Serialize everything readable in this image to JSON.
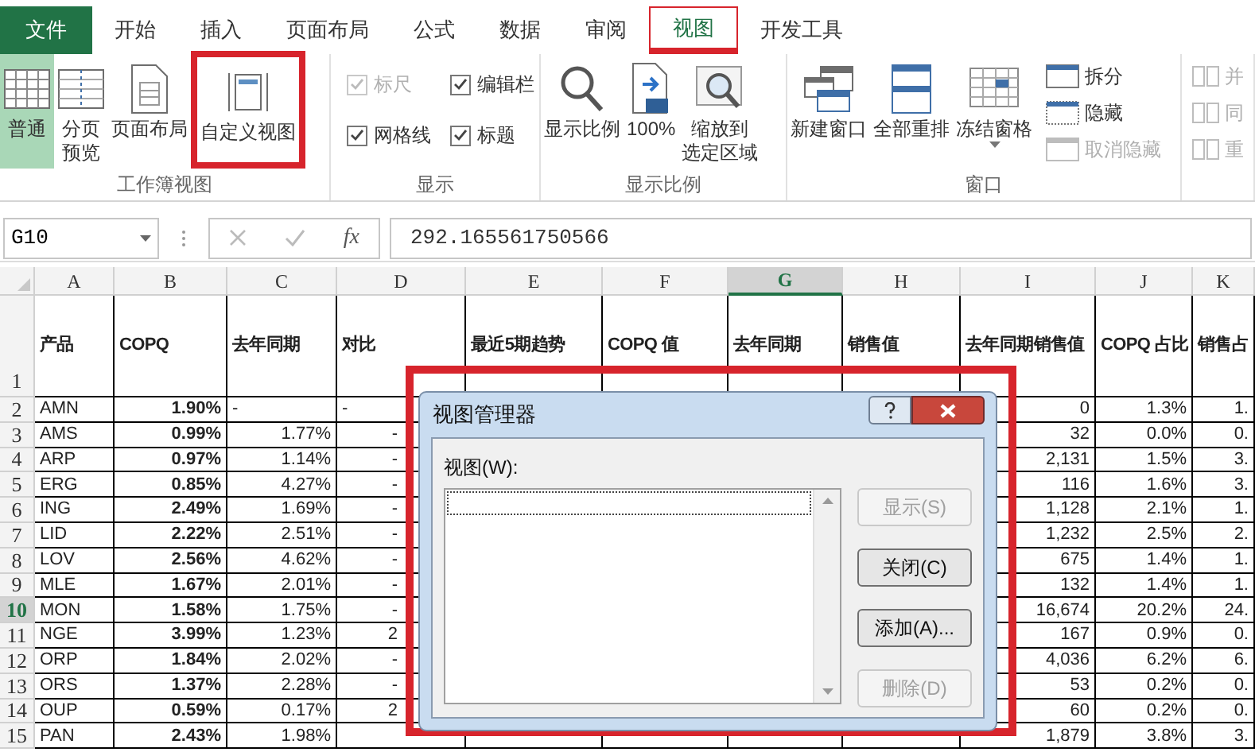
{
  "tabs": [
    {
      "label": "文件",
      "kind": "file",
      "selected": false,
      "highlighted": false
    },
    {
      "label": "开始",
      "kind": "tab",
      "selected": false,
      "highlighted": false
    },
    {
      "label": "插入",
      "kind": "tab",
      "selected": false,
      "highlighted": false
    },
    {
      "label": "页面布局",
      "kind": "tab",
      "selected": false,
      "highlighted": false
    },
    {
      "label": "公式",
      "kind": "tab",
      "selected": false,
      "highlighted": false
    },
    {
      "label": "数据",
      "kind": "tab",
      "selected": false,
      "highlighted": false
    },
    {
      "label": "审阅",
      "kind": "tab",
      "selected": false,
      "highlighted": false
    },
    {
      "label": "视图",
      "kind": "tab",
      "selected": true,
      "highlighted": true
    },
    {
      "label": "开发工具",
      "kind": "tab",
      "selected": false,
      "highlighted": false
    }
  ],
  "ribbon": {
    "groups": [
      {
        "label": "工作簿视图",
        "items": [
          {
            "kind": "large",
            "lines": [
              "普通"
            ],
            "selected": true,
            "highlighted": false
          },
          {
            "kind": "large",
            "lines": [
              "分页",
              "预览"
            ],
            "selected": false,
            "highlighted": false
          },
          {
            "kind": "large",
            "lines": [
              "页面布局"
            ],
            "selected": false,
            "highlighted": false
          },
          {
            "kind": "large",
            "lines": [
              "自定义视图"
            ],
            "selected": false,
            "highlighted": true
          }
        ]
      },
      {
        "label": "显示",
        "items": [
          {
            "kind": "check",
            "label": "标尺",
            "checked": true,
            "disabled": true
          },
          {
            "kind": "check",
            "label": "编辑栏",
            "checked": true,
            "disabled": false
          },
          {
            "kind": "check",
            "label": "网格线",
            "checked": true,
            "disabled": false
          },
          {
            "kind": "check",
            "label": "标题",
            "checked": true,
            "disabled": false
          }
        ]
      },
      {
        "label": "显示比例",
        "items": [
          {
            "kind": "large",
            "lines": [
              "显示比例"
            ],
            "selected": false,
            "highlighted": false
          },
          {
            "kind": "large",
            "lines": [
              "100%"
            ],
            "selected": false,
            "highlighted": false
          },
          {
            "kind": "large",
            "lines": [
              "缩放到",
              "选定区域"
            ],
            "selected": false,
            "highlighted": false
          }
        ]
      },
      {
        "label": "窗口",
        "items": [
          {
            "kind": "large",
            "lines": [
              "新建窗口"
            ],
            "selected": false,
            "highlighted": false
          },
          {
            "kind": "large",
            "lines": [
              "全部重排"
            ],
            "selected": false,
            "highlighted": false
          },
          {
            "kind": "large",
            "lines": [
              "冻结窗格"
            ],
            "selected": false,
            "highlighted": false,
            "dropdown": true
          },
          {
            "kind": "small",
            "label": "拆分",
            "disabled": false
          },
          {
            "kind": "small",
            "label": "隐藏",
            "disabled": false
          },
          {
            "kind": "small",
            "label": "取消隐藏",
            "disabled": true
          }
        ]
      },
      {
        "items": [
          {
            "kind": "small",
            "label": "并",
            "disabled": true
          },
          {
            "kind": "small",
            "label": "同",
            "disabled": true
          },
          {
            "kind": "small",
            "label": "重",
            "disabled": true
          }
        ]
      }
    ]
  },
  "formula_bar": {
    "name_box": "G10",
    "fx": "fx",
    "value": "292.165561750566"
  },
  "sheet": {
    "columns": [
      {
        "label": "A",
        "selected": false
      },
      {
        "label": "B",
        "selected": false
      },
      {
        "label": "C",
        "selected": false
      },
      {
        "label": "D",
        "selected": false
      },
      {
        "label": "E",
        "selected": false
      },
      {
        "label": "F",
        "selected": false
      },
      {
        "label": "G",
        "selected": true
      },
      {
        "label": "H",
        "selected": false
      },
      {
        "label": "I",
        "selected": false
      },
      {
        "label": "J",
        "selected": false
      },
      {
        "label": "K",
        "selected": false
      }
    ],
    "header_row": {
      "number": "1",
      "cells": [
        "产品",
        "COPQ",
        "去年同期",
        "对比",
        "最近5期趋势",
        "COPQ 值",
        "去年同期",
        "销售值",
        "去年同期销售值",
        "COPQ 占比",
        "销售占"
      ]
    },
    "rows": [
      {
        "number": "2",
        "selected": false,
        "cells": [
          "AMN",
          "1.90%",
          {
            "text": "-",
            "left_aligned": true
          },
          {
            "text": "-",
            "left_aligned": true
          },
          null,
          null,
          null,
          null,
          "0",
          "1.3%",
          "1."
        ]
      },
      {
        "number": "3",
        "selected": false,
        "cells": [
          "AMS",
          "0.99%",
          "1.77%",
          {
            "text": "-",
            "clipped": true
          },
          null,
          null,
          null,
          null,
          "32",
          "0.0%",
          "0."
        ]
      },
      {
        "number": "4",
        "selected": false,
        "cells": [
          "ARP",
          "0.97%",
          "1.14%",
          {
            "text": "-",
            "clipped": true
          },
          null,
          null,
          null,
          null,
          "2,131",
          "1.5%",
          "3."
        ]
      },
      {
        "number": "5",
        "selected": false,
        "cells": [
          "ERG",
          "0.85%",
          "4.27%",
          {
            "text": "-",
            "clipped": true
          },
          null,
          null,
          null,
          null,
          "116",
          "1.6%",
          "3."
        ]
      },
      {
        "number": "6",
        "selected": false,
        "cells": [
          "ING",
          "2.49%",
          "1.69%",
          {
            "text": "-",
            "clipped": true
          },
          null,
          null,
          null,
          null,
          "1,128",
          "2.1%",
          "1."
        ]
      },
      {
        "number": "7",
        "selected": false,
        "cells": [
          "LID",
          "2.22%",
          "2.51%",
          {
            "text": "-",
            "clipped": true
          },
          null,
          null,
          null,
          null,
          "1,232",
          "2.5%",
          "2."
        ]
      },
      {
        "number": "8",
        "selected": false,
        "cells": [
          "LOV",
          "2.56%",
          "4.62%",
          {
            "text": "-",
            "clipped": true
          },
          null,
          null,
          null,
          null,
          "675",
          "1.4%",
          "1."
        ]
      },
      {
        "number": "9",
        "selected": false,
        "cells": [
          "MLE",
          "1.67%",
          "2.01%",
          {
            "text": "-",
            "clipped": true
          },
          null,
          null,
          null,
          null,
          "132",
          "1.4%",
          "1."
        ]
      },
      {
        "number": "10",
        "selected": true,
        "cells": [
          "MON",
          "1.58%",
          "1.75%",
          {
            "text": "-",
            "clipped": true
          },
          null,
          null,
          null,
          null,
          "16,674",
          "20.2%",
          "24."
        ]
      },
      {
        "number": "11",
        "selected": false,
        "cells": [
          "NGE",
          "3.99%",
          "1.23%",
          {
            "text": "2",
            "clipped": true
          },
          null,
          null,
          null,
          null,
          "167",
          "0.9%",
          "0."
        ]
      },
      {
        "number": "12",
        "selected": false,
        "cells": [
          "ORP",
          "1.84%",
          "2.02%",
          {
            "text": "-",
            "clipped": true
          },
          null,
          null,
          null,
          null,
          "4,036",
          "6.2%",
          "6."
        ]
      },
      {
        "number": "13",
        "selected": false,
        "cells": [
          "ORS",
          "1.37%",
          "2.28%",
          {
            "text": "-",
            "clipped": true
          },
          null,
          null,
          null,
          null,
          "53",
          "0.2%",
          "0."
        ]
      },
      {
        "number": "14",
        "selected": false,
        "cells": [
          "OUP",
          "0.59%",
          "0.17%",
          {
            "text": "2",
            "clipped": true
          },
          null,
          null,
          null,
          null,
          "60",
          "0.2%",
          "0."
        ]
      },
      {
        "number": "15",
        "selected": false,
        "cells": [
          "PAN",
          "2.43%",
          "1.98%",
          null,
          null,
          null,
          null,
          null,
          "1,879",
          "3.8%",
          "3."
        ]
      }
    ]
  },
  "dialog": {
    "title": "视图管理器",
    "highlighted": true,
    "list_label": "视图(W):",
    "buttons": [
      {
        "label": "显示(S)",
        "disabled": true
      },
      {
        "label": "关闭(C)",
        "disabled": false
      },
      {
        "label": "添加(A)...",
        "disabled": false
      },
      {
        "label": "删除(D)",
        "disabled": true
      }
    ]
  }
}
